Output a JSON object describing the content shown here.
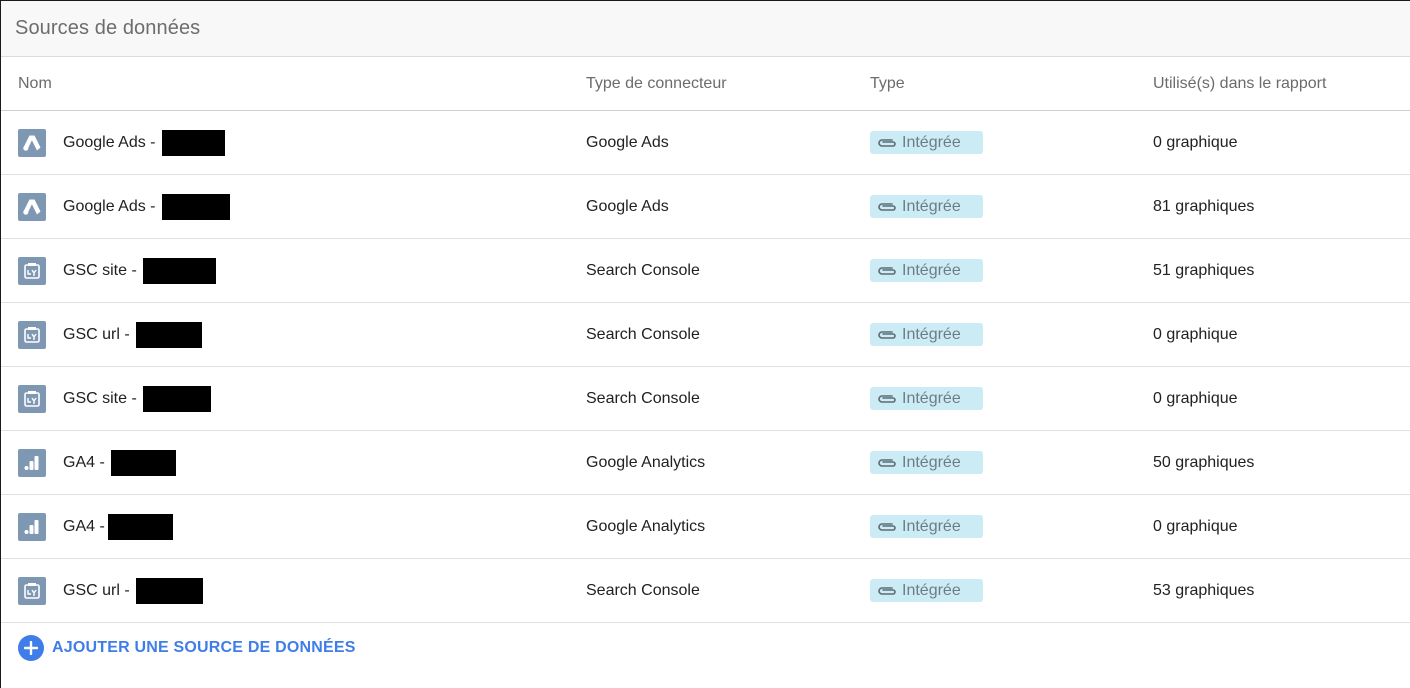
{
  "panel": {
    "title": "Sources de données"
  },
  "table": {
    "columns": {
      "name": "Nom",
      "connector": "Type de connecteur",
      "type": "Type",
      "used": "Utilisé(s) dans le rapport"
    },
    "rows": [
      {
        "icon": "google-ads-icon",
        "name": "Google Ads -",
        "connector": "Google Ads",
        "type": "Intégrée",
        "used": "0 graphique"
      },
      {
        "icon": "google-ads-icon",
        "name": "Google Ads -",
        "connector": "Google Ads",
        "type": "Intégrée",
        "used": "81 graphiques"
      },
      {
        "icon": "search-console-icon",
        "name": "GSC site -",
        "connector": "Search Console",
        "type": "Intégrée",
        "used": "51 graphiques"
      },
      {
        "icon": "search-console-icon",
        "name": "GSC url -",
        "connector": "Search Console",
        "type": "Intégrée",
        "used": "0 graphique"
      },
      {
        "icon": "search-console-icon",
        "name": "GSC site -",
        "connector": "Search Console",
        "type": "Intégrée",
        "used": "0 graphique"
      },
      {
        "icon": "google-analytics-icon",
        "name": "GA4 -",
        "connector": "Google Analytics",
        "type": "Intégrée",
        "used": "50 graphiques"
      },
      {
        "icon": "google-analytics-icon",
        "name": "GA4 -",
        "connector": "Google Analytics",
        "type": "Intégrée",
        "used": "0 graphique"
      },
      {
        "icon": "search-console-icon",
        "name": "GSC url -",
        "connector": "Search Console",
        "type": "Intégrée",
        "used": "53 graphiques"
      }
    ]
  },
  "add_source": {
    "label": "AJOUTER UNE SOURCE DE DONNÉES",
    "icon": "plus-circle-icon"
  },
  "colors": {
    "icon_bg": "#7e98b4",
    "badge_bg": "#ccecf5",
    "accent": "#3f7de8"
  }
}
